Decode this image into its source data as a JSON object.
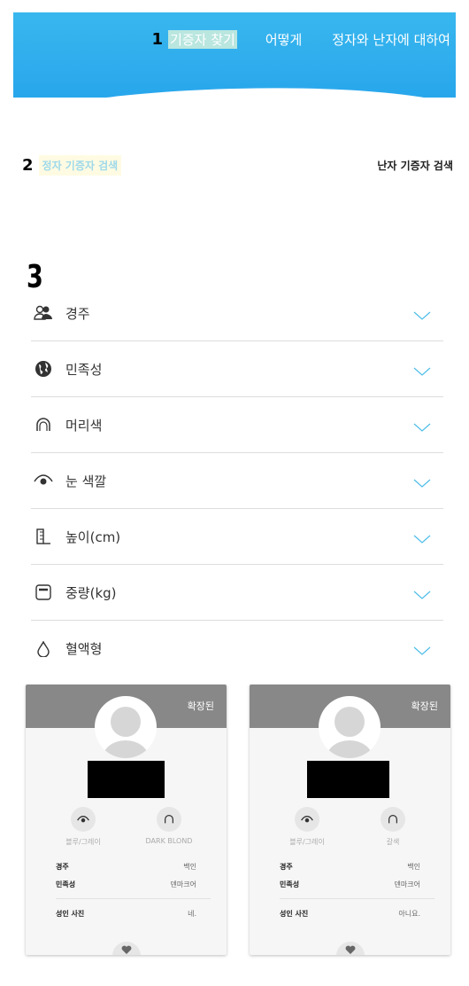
{
  "nav": {
    "step": "1",
    "items": [
      "기증자 찾기",
      "어떻게",
      "정자와 난자에 대하여"
    ]
  },
  "search": {
    "step": "2",
    "tab_active": "정자 기증자 검색",
    "tab_other": "난자 기증자 검색"
  },
  "step3": "3",
  "filters": [
    {
      "label": "경주",
      "icon": "people-icon"
    },
    {
      "label": "민족성",
      "icon": "globe-icon"
    },
    {
      "label": "머리색",
      "icon": "hair-icon"
    },
    {
      "label": "눈 색깔",
      "icon": "eye-icon"
    },
    {
      "label": "높이(cm)",
      "icon": "ruler-icon"
    },
    {
      "label": "중량(kg)",
      "icon": "scale-icon"
    },
    {
      "label": "혈액형",
      "icon": "blood-drop-icon"
    }
  ],
  "cards": [
    {
      "tag": "확장된",
      "eye": "블루/그레이",
      "hair": "DARK BLOND",
      "rows": [
        {
          "k": "경주",
          "v": "백인"
        },
        {
          "k": "민족성",
          "v": "덴마크어"
        },
        {
          "k": "성인 사진",
          "v": "네."
        }
      ]
    },
    {
      "tag": "확장된",
      "eye": "블루/그레이",
      "hair": "갈색",
      "rows": [
        {
          "k": "경주",
          "v": "백인"
        },
        {
          "k": "민족성",
          "v": "덴마크어"
        },
        {
          "k": "성인 사진",
          "v": "아니요."
        }
      ]
    }
  ],
  "colors": {
    "header": "#2aa9ec",
    "chevron": "#4cbde9",
    "band": "#888888"
  }
}
